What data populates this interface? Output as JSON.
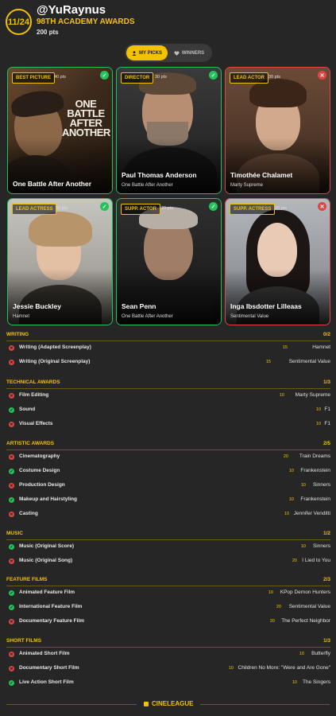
{
  "header": {
    "rank": "11/24",
    "username": "@YuRaynus",
    "event": "98TH ACADEMY AWARDS",
    "points": "200 pts"
  },
  "toggle": {
    "my_picks_label": "MY PICKS",
    "winners_label": "WINNERS",
    "active": "my_picks"
  },
  "picks": [
    {
      "category": "BEST PICTURE",
      "points": "40 pts",
      "name": "One Battle After Another",
      "subtitle": "",
      "result": "correct",
      "poster_title": "ONE BATTLE AFTER ANOTHER"
    },
    {
      "category": "DIRECTOR",
      "points": "30 pts",
      "name": "Paul Thomas Anderson",
      "subtitle": "One Battle After Another",
      "result": "correct"
    },
    {
      "category": "LEAD ACTOR",
      "points": "30 pts",
      "name": "Timothée Chalamet",
      "subtitle": "Marty Supreme",
      "result": "wrong"
    },
    {
      "category": "LEAD ACTRESS",
      "points": "30 pts",
      "name": "Jessie Buckley",
      "subtitle": "Hamnet",
      "result": "correct"
    },
    {
      "category": "SUPP. ACTOR",
      "points": "20 pts",
      "name": "Sean Penn",
      "subtitle": "One Battle After Another",
      "result": "correct"
    },
    {
      "category": "SUPP. ACTRESS",
      "points": "20 pts",
      "name": "Inga Ibsdotter Lilleaas",
      "subtitle": "Sentimental Value",
      "result": "wrong"
    }
  ],
  "sections": [
    {
      "title": "WRITING",
      "score": "0/2",
      "rows": [
        {
          "category": "Writing (Adapted Screenplay)",
          "points": "15",
          "nominee": "Hamnet",
          "result": "wrong"
        },
        {
          "category": "Writing (Original Screenplay)",
          "points": "15",
          "nominee": "Sentimental Value",
          "result": "wrong"
        }
      ]
    },
    {
      "title": "TECHNICAL AWARDS",
      "score": "1/3",
      "rows": [
        {
          "category": "Film Editing",
          "points": "10",
          "nominee": "Marty Supreme",
          "result": "wrong"
        },
        {
          "category": "Sound",
          "points": "10",
          "nominee": "F1",
          "result": "correct"
        },
        {
          "category": "Visual Effects",
          "points": "10",
          "nominee": "F1",
          "result": "wrong"
        }
      ]
    },
    {
      "title": "ARTISTIC AWARDS",
      "score": "2/5",
      "rows": [
        {
          "category": "Cinematography",
          "points": "20",
          "nominee": "Train Dreams",
          "result": "wrong"
        },
        {
          "category": "Costume Design",
          "points": "10",
          "nominee": "Frankenstein",
          "result": "correct"
        },
        {
          "category": "Production Design",
          "points": "10",
          "nominee": "Sinners",
          "result": "wrong"
        },
        {
          "category": "Makeup and Hairstyling",
          "points": "10",
          "nominee": "Frankenstein",
          "result": "correct"
        },
        {
          "category": "Casting",
          "points": "10",
          "nominee": "Jennifer Venditti",
          "result": "wrong"
        }
      ]
    },
    {
      "title": "MUSIC",
      "score": "1/2",
      "rows": [
        {
          "category": "Music (Original Score)",
          "points": "10",
          "nominee": "Sinners",
          "result": "correct"
        },
        {
          "category": "Music (Original Song)",
          "points": "20",
          "nominee": "I Lied to You",
          "result": "wrong"
        }
      ]
    },
    {
      "title": "FEATURE FILMS",
      "score": "2/3",
      "rows": [
        {
          "category": "Animated Feature Film",
          "points": "10",
          "nominee": "KPop Demon Hunters",
          "result": "correct"
        },
        {
          "category": "International Feature Film",
          "points": "20",
          "nominee": "Sentimental Value",
          "result": "correct"
        },
        {
          "category": "Documentary Feature Film",
          "points": "20",
          "nominee": "The Perfect Neighbor",
          "result": "wrong"
        }
      ]
    },
    {
      "title": "SHORT FILMS",
      "score": "1/3",
      "rows": [
        {
          "category": "Animated Short Film",
          "points": "10",
          "nominee": "Butterfly",
          "result": "wrong"
        },
        {
          "category": "Documentary Short Film",
          "points": "10",
          "nominee": "Children No More: \"Were and Are Gone\"",
          "result": "wrong"
        },
        {
          "category": "Live Action Short Film",
          "points": "10",
          "nominee": "The Singers",
          "result": "correct"
        }
      ]
    }
  ],
  "footer": {
    "brand": "CINELEAGUE"
  },
  "colors": {
    "accent": "#f2c200",
    "correct": "#23c25a",
    "wrong": "#e04545",
    "background": "#262626"
  },
  "icons": {
    "correct": "check-icon",
    "wrong": "x-icon",
    "my_picks": "person-icon",
    "winners": "heart-icon",
    "brand": "square-logo-icon"
  }
}
